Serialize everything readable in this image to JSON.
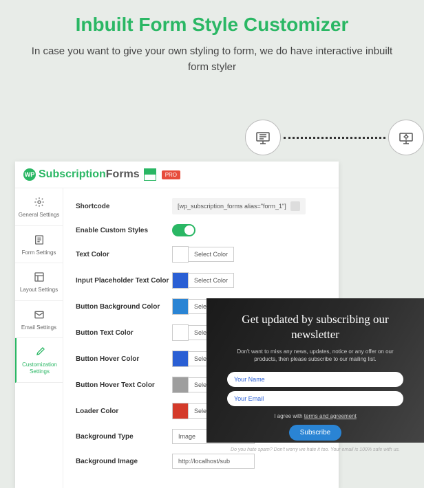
{
  "hero": {
    "title": "Inbuilt Form Style Customizer",
    "desc": "In case you want to give your own styling to form, we do have interactive inbuilt form styler"
  },
  "logo": {
    "wp": "WP",
    "sub": "Subscription",
    "forms": "Forms",
    "pro": "PRO"
  },
  "sidebar": [
    {
      "label": "General Settings"
    },
    {
      "label": "Form Settings"
    },
    {
      "label": "Layout Settings"
    },
    {
      "label": "Email Settings"
    },
    {
      "label": "Customization Settings"
    }
  ],
  "rows": {
    "shortcode_label": "Shortcode",
    "shortcode_value": "[wp_subscription_forms alias=\"form_1\"]",
    "enable_label": "Enable Custom Styles",
    "select_color": "Select Color",
    "text_color": {
      "label": "Text Color",
      "swatch": "#ffffff"
    },
    "placeholder_color": {
      "label": "Input Placeholder Text Color",
      "swatch": "#2a5fd4"
    },
    "btn_bg": {
      "label": "Button Background Color",
      "swatch": "#2a84d4"
    },
    "btn_text": {
      "label": "Button Text Color",
      "swatch": "#ffffff"
    },
    "btn_hover": {
      "label": "Button Hover Color",
      "swatch": "#2a5fd4"
    },
    "btn_hover_text": {
      "label": "Button Hover Text Color",
      "swatch": "#9e9e9e"
    },
    "loader": {
      "label": "Loader Color",
      "swatch": "#d43a2a"
    },
    "bg_type_label": "Background Type",
    "bg_type_value": "Image",
    "bg_image_label": "Background Image",
    "bg_image_value": "http://localhost/sub"
  },
  "preview": {
    "heading": "Get updated by subscribing our newsletter",
    "sub": "Don't want to miss any news, updates, notice or any offer on our products, then please subscribe to our mailing list.",
    "name_ph": "Your Name",
    "email_ph": "Your Email",
    "agree_pre": "I agree with ",
    "agree_link": "terms and agreement",
    "btn": "Subscribe",
    "spam": "Do you hate spam? Don't worry we hate it too. Your email is 100% safe with us."
  }
}
